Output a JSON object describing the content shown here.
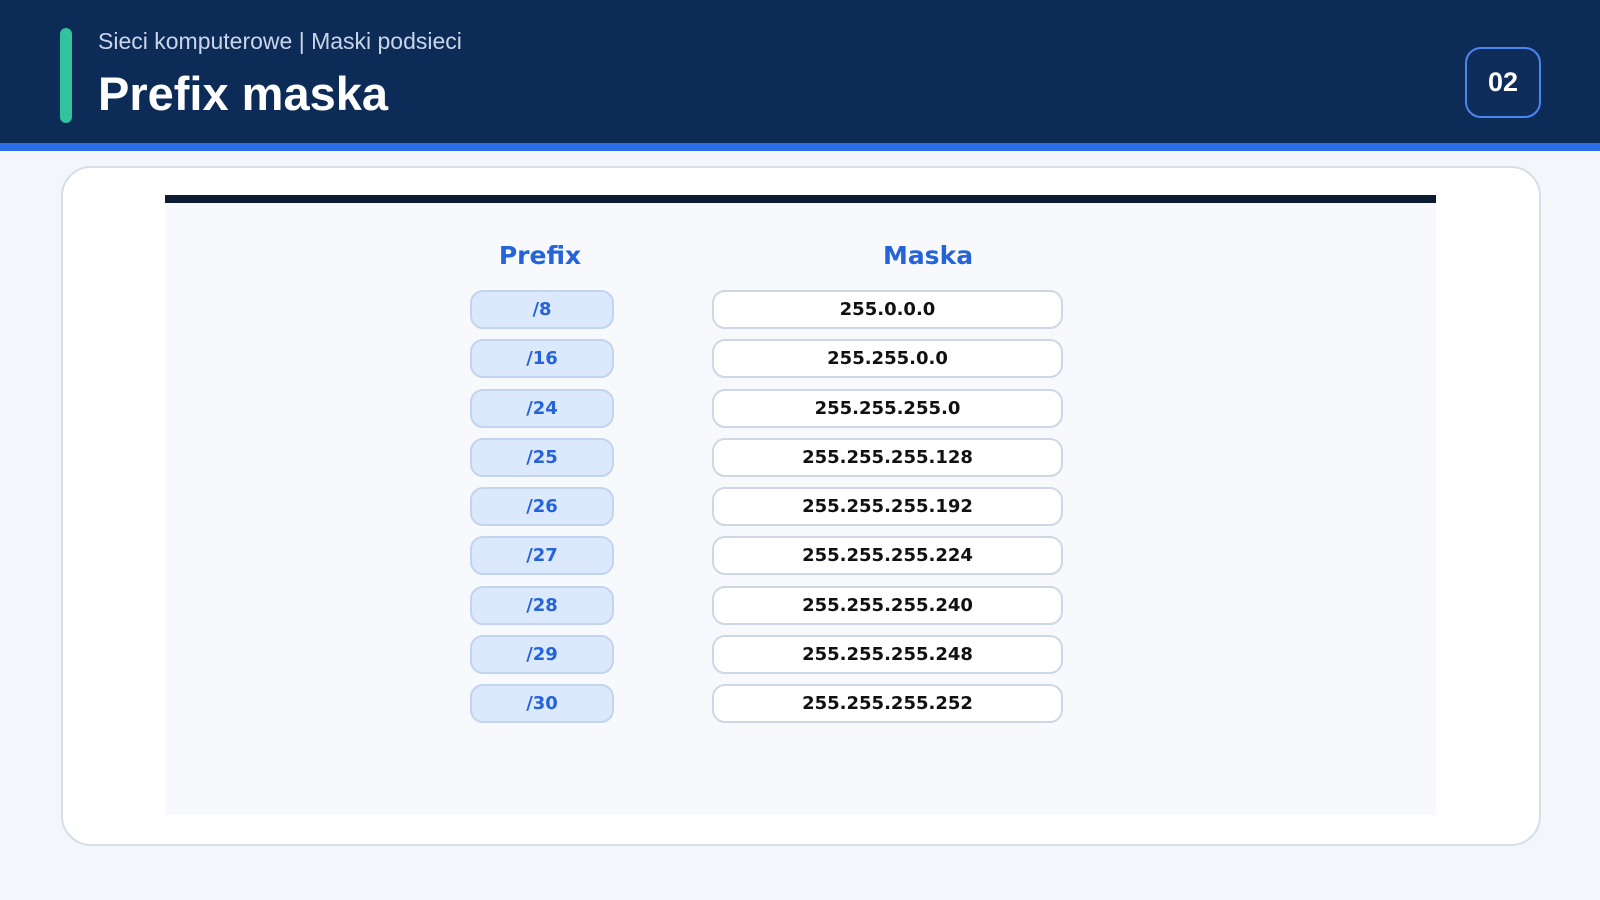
{
  "header": {
    "subtitle": "Sieci komputerowe | Maski podsieci",
    "title": "Prefix maska",
    "page_number": "02"
  },
  "table": {
    "prefix_header": "Prefix",
    "mask_header": "Maska",
    "rows": [
      {
        "prefix": "/8",
        "mask": "255.0.0.0"
      },
      {
        "prefix": "/16",
        "mask": "255.255.0.0"
      },
      {
        "prefix": "/24",
        "mask": "255.255.255.0"
      },
      {
        "prefix": "/25",
        "mask": "255.255.255.128"
      },
      {
        "prefix": "/26",
        "mask": "255.255.255.192"
      },
      {
        "prefix": "/27",
        "mask": "255.255.255.224"
      },
      {
        "prefix": "/28",
        "mask": "255.255.255.240"
      },
      {
        "prefix": "/29",
        "mask": "255.255.255.248"
      },
      {
        "prefix": "/30",
        "mask": "255.255.255.252"
      }
    ]
  },
  "colors": {
    "header_bg": "#0d2b57",
    "accent": "#2fc49b",
    "link_blue": "#2563d9"
  }
}
